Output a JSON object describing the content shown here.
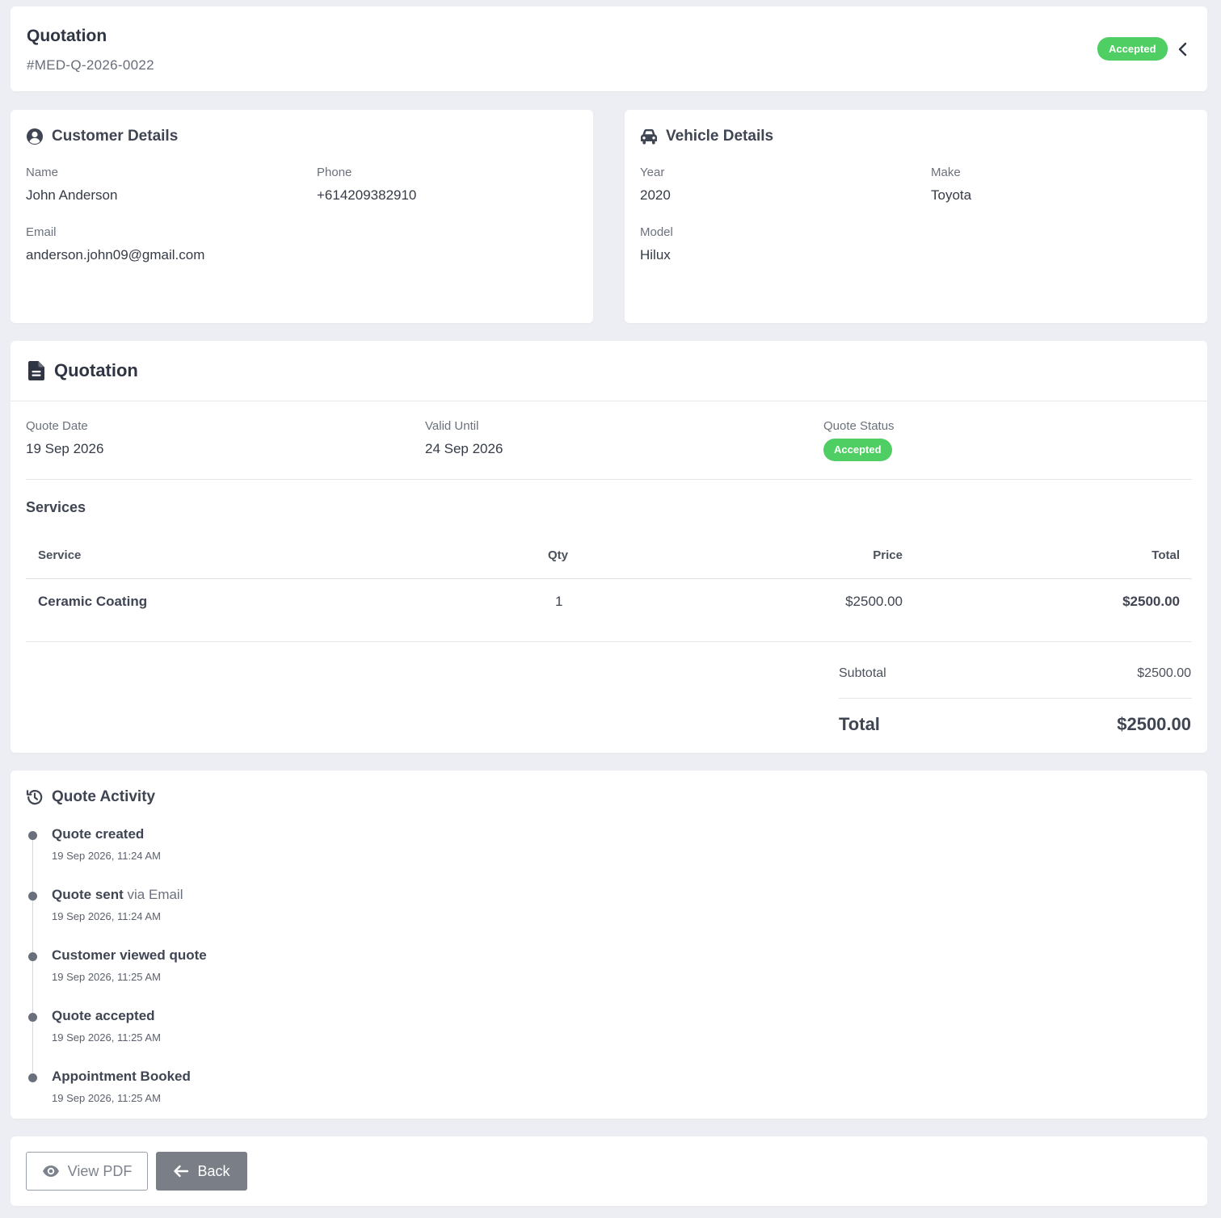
{
  "header": {
    "title": "Quotation",
    "quote_number": "#MED-Q-2026-0022",
    "status_badge": "Accepted"
  },
  "customer": {
    "title": "Customer Details",
    "name_label": "Name",
    "name": "John Anderson",
    "phone_label": "Phone",
    "phone": "+614209382910",
    "email_label": "Email",
    "email": "anderson.john09@gmail.com"
  },
  "vehicle": {
    "title": "Vehicle Details",
    "year_label": "Year",
    "year": "2020",
    "make_label": "Make",
    "make": "Toyota",
    "model_label": "Model",
    "model": "Hilux"
  },
  "quotation": {
    "title": "Quotation",
    "quote_date_label": "Quote Date",
    "quote_date": "19 Sep 2026",
    "valid_until_label": "Valid Until",
    "valid_until": "24 Sep 2026",
    "status_label": "Quote Status",
    "status": "Accepted",
    "services_title": "Services",
    "columns": {
      "service": "Service",
      "qty": "Qty",
      "price": "Price",
      "total": "Total"
    },
    "rows": [
      {
        "service": "Ceramic Coating",
        "qty": "1",
        "price": "$2500.00",
        "total": "$2500.00"
      }
    ],
    "subtotal_label": "Subtotal",
    "subtotal": "$2500.00",
    "total_label": "Total",
    "total": "$2500.00"
  },
  "activity": {
    "title": "Quote Activity",
    "items": [
      {
        "action": "Quote created",
        "extra": "",
        "time": "19 Sep 2026, 11:24 AM"
      },
      {
        "action": "Quote sent",
        "extra": " via Email",
        "time": "19 Sep 2026, 11:24 AM"
      },
      {
        "action": "Customer viewed quote",
        "extra": "",
        "time": "19 Sep 2026, 11:25 AM"
      },
      {
        "action": "Quote accepted",
        "extra": "",
        "time": "19 Sep 2026, 11:25 AM"
      },
      {
        "action": "Appointment Booked",
        "extra": "",
        "time": "19 Sep 2026, 11:25 AM"
      }
    ]
  },
  "footer": {
    "view_pdf_label": "View PDF",
    "back_label": "Back"
  },
  "colors": {
    "accent_green": "#4fcf63",
    "back_button": "#7a7f87",
    "background": "#eceef3"
  },
  "icons": {
    "customer": "user-circle-icon",
    "vehicle": "car-icon",
    "quotation": "document-icon",
    "activity": "history-icon",
    "view_pdf": "eye-icon",
    "back": "arrow-left-icon",
    "collapse": "chevron-left-icon"
  }
}
